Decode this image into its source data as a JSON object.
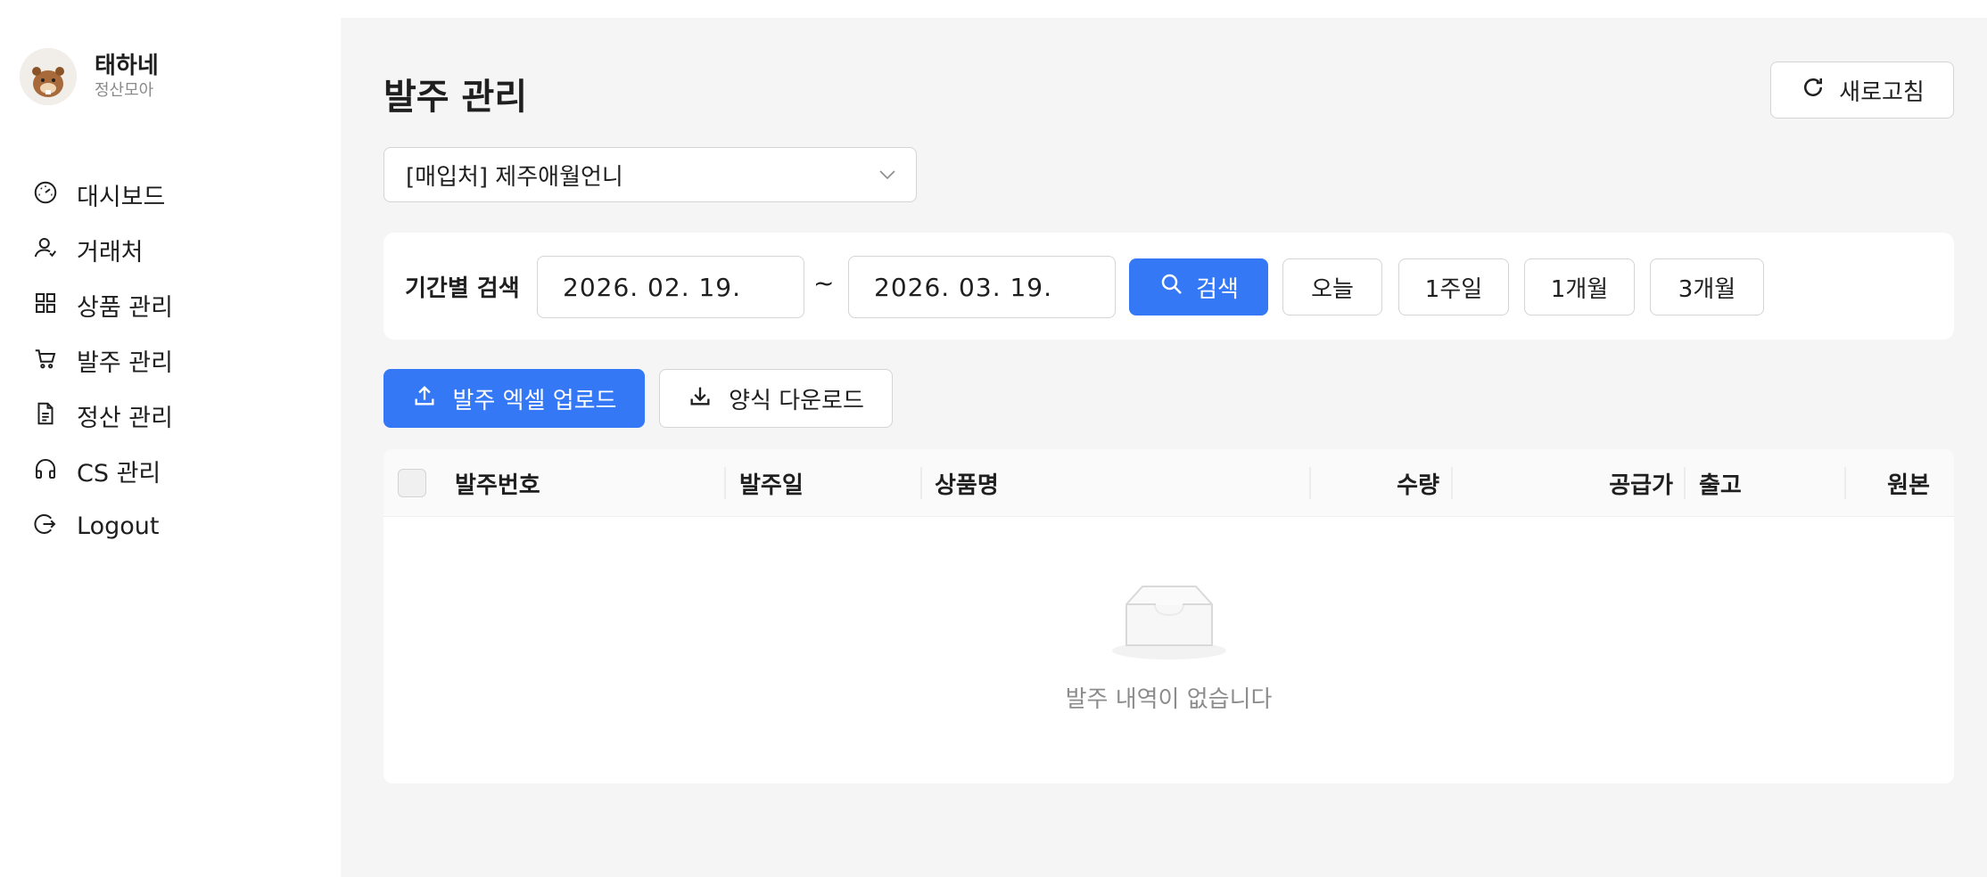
{
  "brand": {
    "name": "태하네",
    "subtitle": "정산모아"
  },
  "nav": [
    {
      "label": "대시보드",
      "icon": "dashboard-icon"
    },
    {
      "label": "거래처",
      "icon": "user-icon"
    },
    {
      "label": "상품 관리",
      "icon": "grid-icon"
    },
    {
      "label": "발주 관리",
      "icon": "cart-icon"
    },
    {
      "label": "정산 관리",
      "icon": "document-icon"
    },
    {
      "label": "CS 관리",
      "icon": "headset-icon"
    },
    {
      "label": "Logout",
      "icon": "logout-icon"
    }
  ],
  "page": {
    "title": "발주 관리",
    "refresh_label": "새로고침"
  },
  "vendor_select": {
    "value": "[매입처] 제주애월언니"
  },
  "filter": {
    "label": "기간별 검색",
    "start_date": "2026. 02. 19.",
    "separator": "~",
    "end_date": "2026. 03. 19.",
    "search_label": "검색",
    "ranges": [
      "오늘",
      "1주일",
      "1개월",
      "3개월"
    ]
  },
  "actions": {
    "upload_label": "발주 엑셀 업로드",
    "download_label": "양식 다운로드"
  },
  "table": {
    "columns": [
      "발주번호",
      "발주일",
      "상품명",
      "수량",
      "공급가",
      "출고",
      "원본"
    ],
    "empty_text": "발주 내역이 없습니다"
  },
  "colors": {
    "accent": "#3478f6",
    "background": "#f5f5f5"
  }
}
